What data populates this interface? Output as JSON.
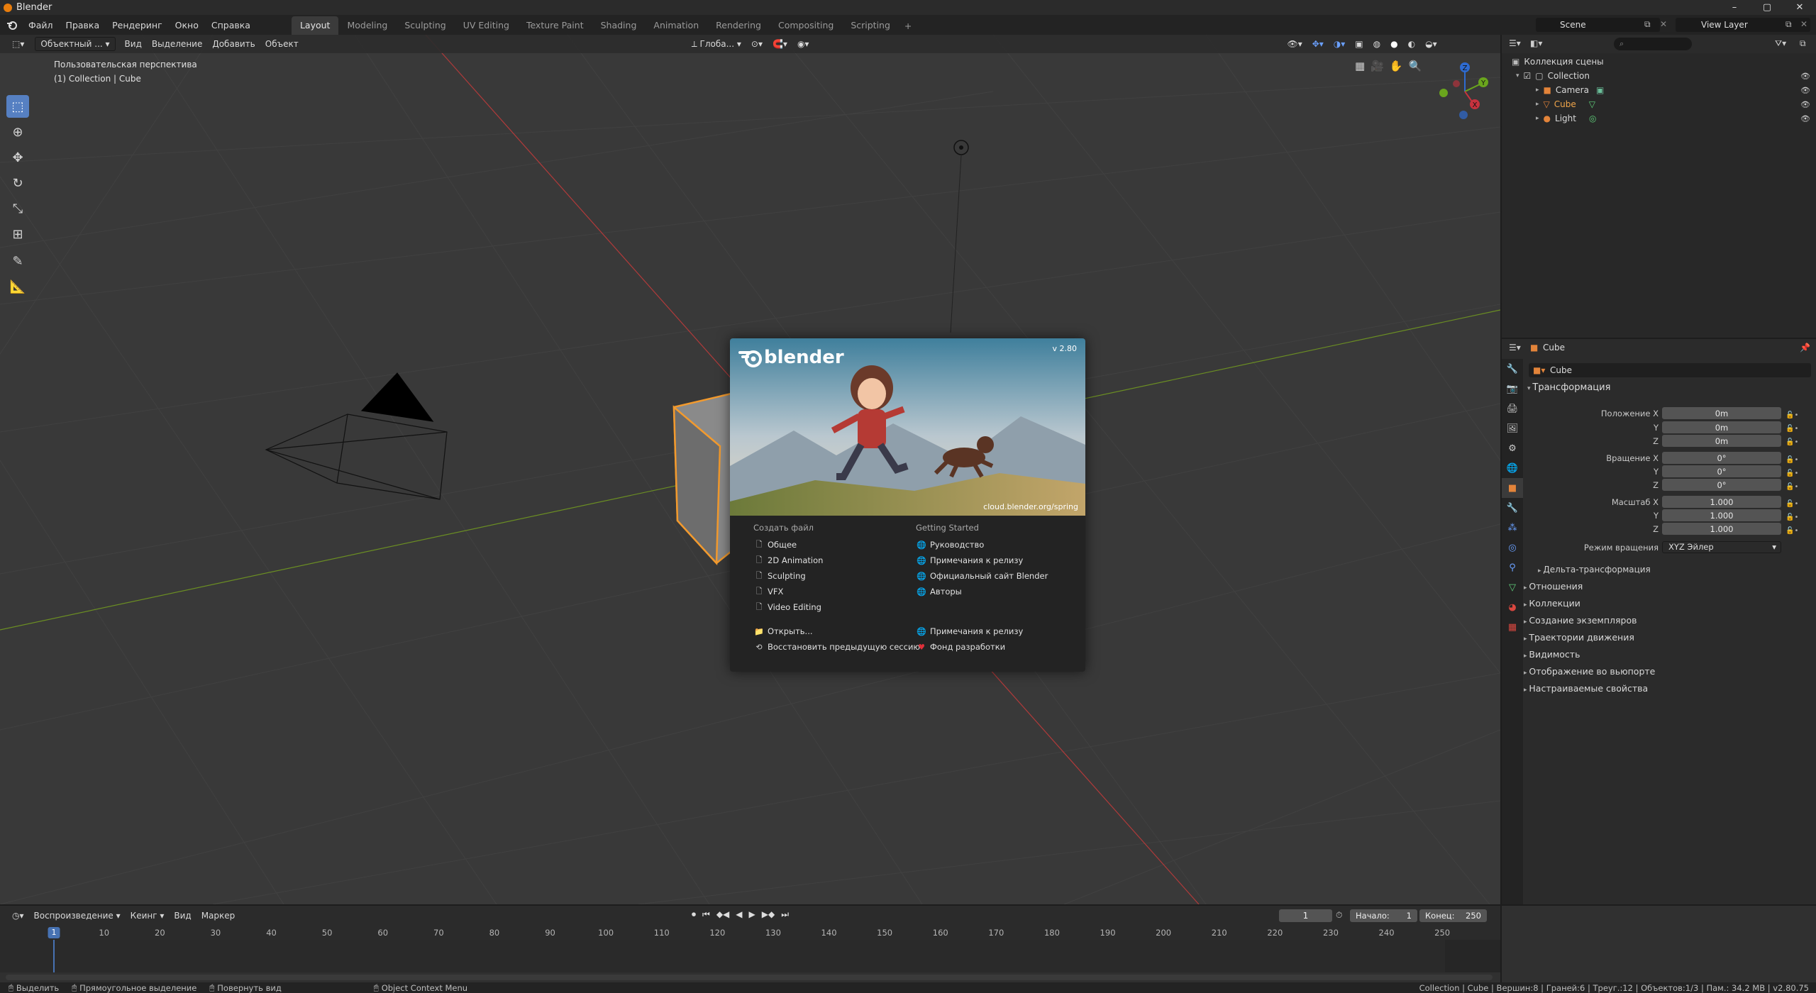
{
  "window": {
    "title": "Blender",
    "min": "–",
    "max": "▢",
    "close": "✕"
  },
  "menu": [
    "Файл",
    "Правка",
    "Рендеринг",
    "Окно",
    "Справка"
  ],
  "workspaces": [
    "Layout",
    "Modeling",
    "Sculpting",
    "UV Editing",
    "Texture Paint",
    "Shading",
    "Animation",
    "Rendering",
    "Compositing",
    "Scripting"
  ],
  "scene": "Scene",
  "view_layer": "View Layer",
  "viewport": {
    "mode": "Объектный ...",
    "menus": [
      "Вид",
      "Выделение",
      "Добавить",
      "Объект"
    ],
    "orientation": "Глоба...",
    "info_line1": "Пользовательская перспектива",
    "info_line2": "(1) Collection | Cube",
    "gizmo_labels": [
      "Z",
      "Y",
      "X"
    ]
  },
  "splash": {
    "logo_text": "blender",
    "version": "v 2.80",
    "credit": "cloud.blender.org/spring",
    "create_header": "Создать файл",
    "create_items": [
      "Общее",
      "2D Animation",
      "Sculpting",
      "VFX",
      "Video Editing"
    ],
    "getting_header": "Getting Started",
    "getting_items": [
      "Руководство",
      "Примечания к релизу",
      "Официальный сайт Blender",
      "Авторы"
    ],
    "open": "Открыть...",
    "recover": "Восстановить предыдущую сессию",
    "release_notes": "Примечания к релизу",
    "fund": "Фонд разработки"
  },
  "outliner": {
    "root": "Коллекция сцены",
    "collection": "Collection",
    "items": [
      "Camera",
      "Cube",
      "Light"
    ]
  },
  "properties": {
    "object_name": "Cube",
    "data_name": "Cube",
    "transform_header": "Трансформация",
    "location_label": "Положение X",
    "rotation_label": "Вращение X",
    "scale_label": "Масштаб X",
    "y": "Y",
    "z": "Z",
    "location": [
      "0m",
      "0m",
      "0m"
    ],
    "rotation": [
      "0°",
      "0°",
      "0°"
    ],
    "scale": [
      "1.000",
      "1.000",
      "1.000"
    ],
    "rotation_mode_label": "Режим вращения",
    "rotation_mode": "XYZ Эйлер",
    "delta": "Дельта-трансформация",
    "panels": [
      "Отношения",
      "Коллекции",
      "Создание экземпляров",
      "Траектории движения",
      "Видимость",
      "Отображение во вьюпорте",
      "Настраиваемые свойства"
    ]
  },
  "timeline": {
    "menus": [
      "Воспроизведение",
      "Кеинг",
      "Вид",
      "Маркер"
    ],
    "current_frame": "1",
    "start_label": "Начало:",
    "start": "1",
    "end_label": "Конец:",
    "end": "250",
    "ticks": [
      "10",
      "20",
      "30",
      "40",
      "50",
      "60",
      "70",
      "80",
      "90",
      "100",
      "110",
      "120",
      "130",
      "140",
      "150",
      "160",
      "170",
      "180",
      "190",
      "200",
      "210",
      "220",
      "230",
      "240",
      "250"
    ],
    "playhead": "1"
  },
  "status": {
    "select": "Выделить",
    "box": "Прямоугольное выделение",
    "rotate": "Повернуть вид",
    "context": "Object Context Menu",
    "stats": "Collection | Cube | Вершин:8 | Граней:6 | Треуг.:12 | Объектов:1/3 | Пам.: 34.2 MB | v2.80.75"
  }
}
